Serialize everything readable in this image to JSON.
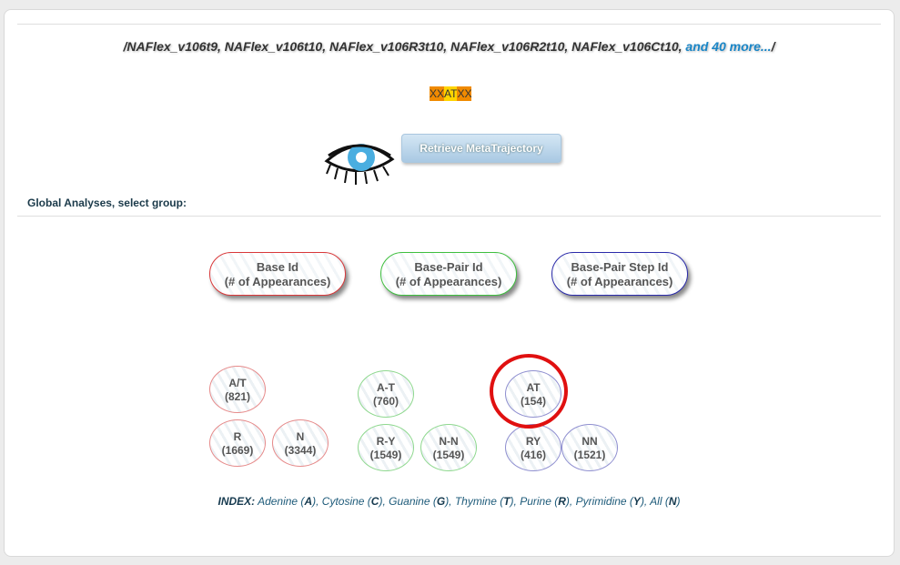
{
  "trajectories": {
    "prefix": "/",
    "list": "NAFlex_v106t9, NAFlex_v106t10, NAFlex_v106R3t10, NAFlex_v106R2t10, NAFlex_v106Ct10,",
    "more_link": "and 40 more...",
    "suffix": "/"
  },
  "sequence": {
    "xx1": "XX",
    "at": "AT",
    "xx2": "XX"
  },
  "retrieve_button": "Retrieve MetaTrajectory",
  "global_label": "Global Analyses, select group:",
  "groups": [
    {
      "line1": "Base Id",
      "line2": "(# of Appearances)"
    },
    {
      "line1": "Base-Pair Id",
      "line2": "(# of Appearances)"
    },
    {
      "line1": "Base-Pair Step Id",
      "line2": "(# of Appearances)"
    }
  ],
  "base_id": [
    {
      "label": "A/T",
      "count": "(821)"
    },
    {
      "label": "R",
      "count": "(1669)"
    },
    {
      "label": "N",
      "count": "(3344)"
    }
  ],
  "base_pair_id": [
    {
      "label": "A-T",
      "count": "(760)"
    },
    {
      "label": "R-Y",
      "count": "(1549)"
    },
    {
      "label": "N-N",
      "count": "(1549)"
    }
  ],
  "step_id": [
    {
      "label": "AT",
      "count": "(154)"
    },
    {
      "label": "RY",
      "count": "(416)"
    },
    {
      "label": "NN",
      "count": "(1521)"
    }
  ],
  "index": {
    "title": "INDEX:",
    "adenine": "Adenine (",
    "A": "A",
    "cytosine": "), Cytosine (",
    "C": "C",
    "guanine": "), Guanine (",
    "G": "G",
    "thymine": "), Thymine (",
    "T": "T",
    "purine": "), Purine (",
    "R": "R",
    "pyrimidine": "), Pyrimidine (",
    "Y": "Y",
    "all": "), All (",
    "N": "N",
    "close": ")"
  },
  "colors": {
    "red": "#d9383a",
    "green": "#3fbf3f",
    "blue": "#2b2baa",
    "link": "#1a86c7",
    "highlight": "#e01010"
  }
}
